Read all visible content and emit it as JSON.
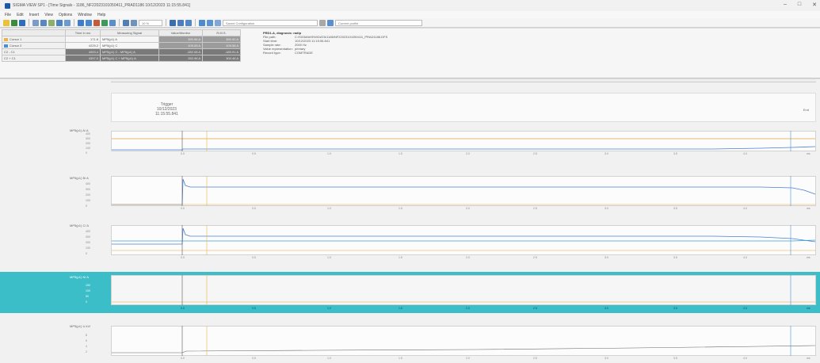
{
  "window": {
    "title": "SIGMA VIEW SP1 - [Time Signals - 1186_NF22023101050411_PRAD1186 10/12/2023 11:15:55.841]",
    "minimize": "–",
    "maximize": "□",
    "close": "✕"
  },
  "menu": [
    "File",
    "Edit",
    "Insert",
    "View",
    "Options",
    "Window",
    "Help"
  ],
  "toolbar": {
    "zoom_value": "10 %",
    "config_select": "Saved Configuration",
    "cursor_select": "Current profile"
  },
  "cursor_table": {
    "headers": [
      "",
      "Time in ms",
      "Measuring Signal",
      "Value/Monitor",
      "R.M.S."
    ],
    "rows": [
      {
        "label": "Cursor 1",
        "time": "171.8",
        "signal": "MP5(p1) A",
        "value": "390.96 A",
        "rms": "390.90 A"
      },
      {
        "label": "Cursor 2",
        "time": "4225.2",
        "signal": "MP5(p1) C",
        "value": "109.05 A",
        "rms": "109.58 A"
      },
      {
        "label": "C2 - C1",
        "time": "4053.4",
        "signal": "MP5(p1) C - MP5(p1) A",
        "value": "-282.08 A",
        "rms": "-189.91 A"
      },
      {
        "label": "C2 + C1",
        "time": "4397.0",
        "signal": "MP5(p1) C + MP5(p1) A",
        "value": "252.96 A",
        "rms": "300.46 A"
      }
    ]
  },
  "info": {
    "title": "PRD1-A, diagnosis: radip",
    "fields": [
      {
        "key": "File path:",
        "value": "C:\\SIGMAVIEW\\DATA\\1186\\NF22023101050411_PRAD1186.DFS"
      },
      {
        "key": "Start time:",
        "value": "10/12/2023 11:15:55.841"
      },
      {
        "key": "Sample rate:",
        "value": "2000 Hz"
      },
      {
        "key": "Value representation:",
        "value": "primary"
      },
      {
        "key": "Record type:",
        "value": "COMTRADE"
      }
    ]
  },
  "trigger": {
    "title": "Trigger",
    "date": "10/12/2023",
    "time": "11:15:55.841",
    "end_label": "End"
  },
  "x_ticks": [
    "0.0",
    "0.5",
    "1.0",
    "1.5",
    "2.0",
    "2.5",
    "3.0",
    "3.5",
    "4.0"
  ],
  "x_unit": "ms",
  "panels": [
    {
      "name": "MP5(p1) A/ A",
      "y_ticks": [
        "400",
        "300",
        "200",
        "100",
        "0"
      ]
    },
    {
      "name": "MP5(p1) B/ A",
      "y_ticks": [
        "400",
        "300",
        "200",
        "100",
        "0"
      ]
    },
    {
      "name": "MP5(p1) C/ A",
      "y_ticks": [
        "400",
        "300",
        "200",
        "100",
        "0"
      ]
    },
    {
      "name": "MP5(p1) N/ A",
      "y_ticks": [
        "150",
        "100",
        "50",
        "0"
      ]
    },
    {
      "name": "MP5(p1) U kV/",
      "y_ticks": [
        "8",
        "6",
        "4",
        "2"
      ]
    }
  ],
  "colors": {
    "accent_panel": "#3bbec8",
    "trace_orange": "#e6a23c",
    "trace_blue": "#4a7fd6",
    "cursor_1": "#e7b64a",
    "cursor_2": "#4a8fd6"
  }
}
